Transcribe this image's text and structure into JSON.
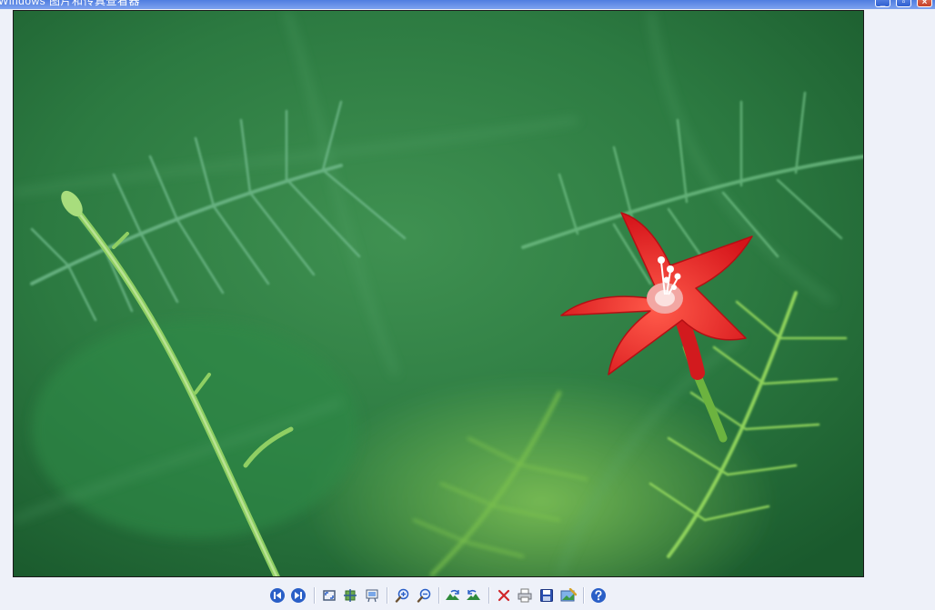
{
  "window": {
    "title": "Windows 图片和传真查看器",
    "buttons": [
      {
        "name": "minimize",
        "icon": "minimize-icon"
      },
      {
        "name": "maximize",
        "icon": "maximize-icon"
      },
      {
        "name": "close",
        "icon": "close-icon"
      }
    ]
  },
  "image": {
    "subject": "red star-shaped flower with feathery green leaves",
    "colors": {
      "flower": "#e3161c",
      "foliage_dark": "#1f6a34",
      "foliage_light": "#7bc64e"
    }
  },
  "toolbar": {
    "buttons": [
      {
        "name": "previous-image",
        "icon": "previous-icon"
      },
      {
        "name": "next-image",
        "icon": "next-icon"
      },
      {
        "name": "best-fit",
        "icon": "best-fit-icon"
      },
      {
        "name": "actual-size",
        "icon": "actual-size-icon"
      },
      {
        "name": "slide-show",
        "icon": "slideshow-icon"
      },
      {
        "name": "zoom-in",
        "icon": "zoom-in-icon"
      },
      {
        "name": "zoom-out",
        "icon": "zoom-out-icon"
      },
      {
        "name": "rotate-clockwise",
        "icon": "rotate-clockwise-icon"
      },
      {
        "name": "rotate-counterclockwise",
        "icon": "rotate-counterclockwise-icon"
      },
      {
        "name": "delete",
        "icon": "delete-icon"
      },
      {
        "name": "print",
        "icon": "print-icon"
      },
      {
        "name": "copy-to",
        "icon": "save-icon"
      },
      {
        "name": "open-for-editing",
        "icon": "edit-icon"
      },
      {
        "name": "help",
        "icon": "help-icon"
      }
    ]
  }
}
